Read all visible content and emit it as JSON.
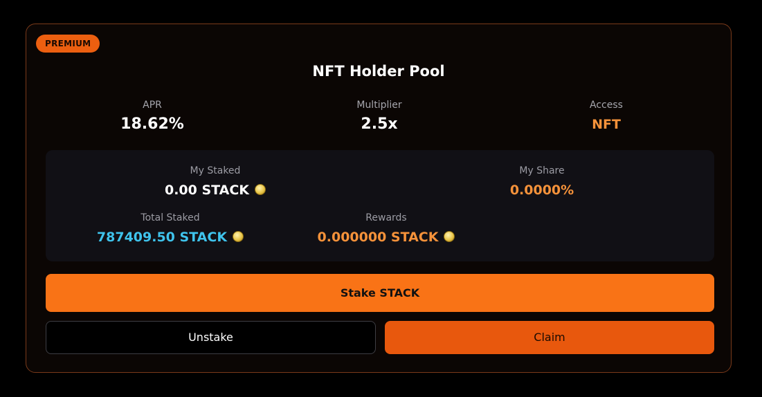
{
  "pool": {
    "badge": "PREMIUM",
    "title": "NFT Holder Pool"
  },
  "stats": {
    "apr_label": "APR",
    "apr_value": "18.62%",
    "multiplier_label": "Multiplier",
    "multiplier_value": "2.5x",
    "access_label": "Access",
    "access_value": "NFT"
  },
  "panel": {
    "my_staked_label": "My Staked",
    "my_staked_value": "0.00 STACK",
    "my_share_label": "My Share",
    "my_share_value": "0.0000%",
    "total_staked_label": "Total Staked",
    "total_staked_value": "787409.50 STACK",
    "rewards_label": "Rewards",
    "rewards_value": "0.000000 STACK",
    "token_icon": "coin-icon"
  },
  "actions": {
    "stake_label": "Stake STACK",
    "unstake_label": "Unstake",
    "claim_label": "Claim"
  },
  "colors": {
    "accent": "#f97316",
    "claim": "#e8580d",
    "highlight_orange": "#f5923a",
    "highlight_cyan": "#3fc3ec",
    "border": "#7a3a1a"
  }
}
